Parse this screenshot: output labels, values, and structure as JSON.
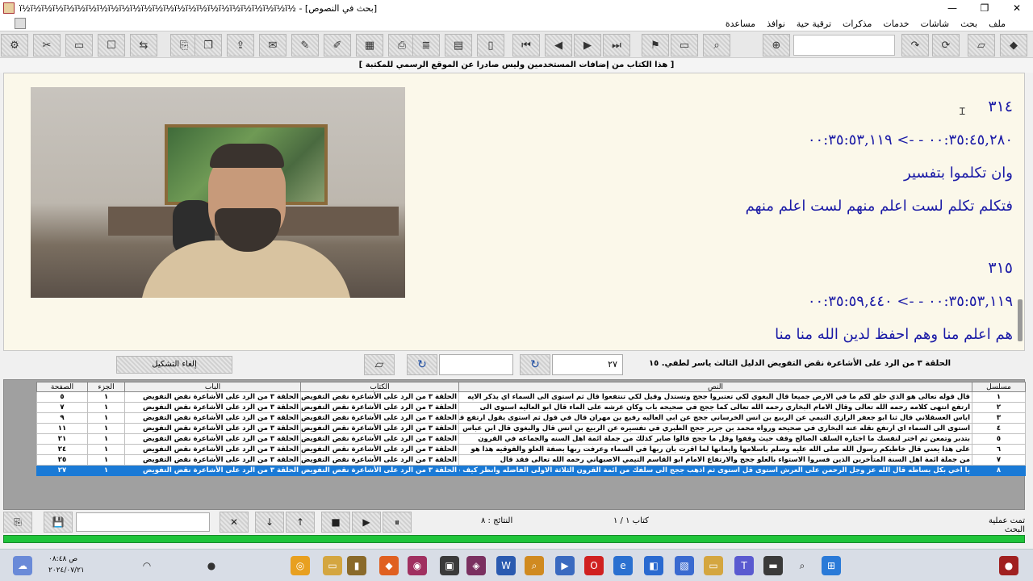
{
  "window": {
    "title": "[بحث في النصوص] - ½ï½ï½ï½ï½ï½ï½ï½ï½ï½ï½ï½ï½ï½ï½ï½ï½ï½ï½ï½ï½ï½ï½ï½ï½ï",
    "minimize": "—",
    "maximize": "❐",
    "close": "✕"
  },
  "menu": [
    "ملف",
    "بحث",
    "شاشات",
    "خدمات",
    "مذكرات",
    "ترقية حية",
    "نوافذ",
    "مساعدة"
  ],
  "notice": "[ هذا الكتاب من إضافات المستخدمين وليس صادرا عن الموقع الرسمي للمكتبة ]",
  "viewer": {
    "lines": [
      {
        "kind": "num",
        "text": "٣١٤"
      },
      {
        "kind": "ts",
        "text": "٠٠:٣٥:٤٥,٢٨٠ - -> ٠٠:٣٥:٥٣,١١٩"
      },
      {
        "kind": "txt",
        "text": "وان تكلموا بتفسير"
      },
      {
        "kind": "txt",
        "text": "فتكلم تكلم لست اعلم منهم لست اعلم منهم"
      },
      {
        "kind": "num",
        "text": "٣١٥"
      },
      {
        "kind": "ts",
        "text": "٠٠:٣٥:٥٣,١١٩ - -> ٠٠:٣٥:٥٩,٤٤٠"
      },
      {
        "kind": "txt",
        "text": "هم اعلم منا وهم احفظ لدين الله منا منا"
      }
    ]
  },
  "panel": {
    "doc_title": "الحلقة ٣ من الرد على الأشاعرة نقض التفويض الدليل الثالث ياسر لطفي. ١٥",
    "page_field": "٢٧",
    "field2": "",
    "ordered_btn": "إلغاء التشكيل"
  },
  "results": {
    "headers": [
      "مسلسل",
      "النص",
      "الكتاب",
      "الباب",
      "الجزء",
      "الصفحة"
    ],
    "rows": [
      [
        "١",
        "قال قوله تعالى هو الذي خلق لكم ما في الارض جميعا قال البغوي لكي تعتبروا ججج وتستدل وقيل لكي تنتفعوا قال ثم استوى الى السماء اي يذكر الايه",
        "الحلقة ٣ من الرد على الأشاعرة نقض التفويض",
        "الحلقة ٣ من الرد على الأشاعرة نقض التفويض",
        "١",
        "٥"
      ],
      [
        "٢",
        "ارتفع انتهى كلامه رحمه الله تعالى وقال الامام البخاري رحمه الله تعالى كما ججج في صحيحه باب وكان عرشه على الماء قال ابو العاليه استوى الى",
        "الحلقة ٣ من الرد على الأشاعرة نقض التفويض",
        "الحلقة ٣ من الرد على الأشاعرة نقض التفويض",
        "١",
        "٧"
      ],
      [
        "٣",
        "اياس العسقلاني قال ثنا ابو جعفر الرازي التيمي عن الربيع بن انس الخرساني ججج عن ابي العاليه رفيع بن مهران قال في قول ثم استوى يقول ارتفع قال",
        "الحلقة ٣ من الرد على الأشاعرة نقض التفويض",
        "الحلقة ٣ من الرد على الأشاعرة نقض التفويض",
        "١",
        "٩"
      ],
      [
        "٤",
        "استوى الى السماء اي ارتفع نقله عنه البخاري في صحيحه ورواه محمد بن جرير ججج الطبري في تفسيره عن الربيع بن انس قال والبغوي قال ابن عباس",
        "الحلقة ٣ من الرد على الأشاعرة نقض التفويض",
        "الحلقة ٣ من الرد على الأشاعرة نقض التفويض",
        "١",
        "١١"
      ],
      [
        "٥",
        "بتدبر وتمعن ثم اختر لنفسك ما اختاره السلف الصالح وقف حيث وقفوا وقل ما ججج قالوا صابر كذلك من جملة ائمة اهل السنه والجماعه في القرون",
        "الحلقة ٣ من الرد على الأشاعرة نقض التفويض",
        "الحلقة ٣ من الرد على الأشاعرة نقض التفويض",
        "١",
        "٢١"
      ],
      [
        "٦",
        "على هذا يعني قال خاطبكم رسول الله صلى الله عليه وسلم باسلامها وايمانها لما اقرت بان ربها في السماء وعرفت ربها بصفة العلو والفوقيه هذا هو",
        "الحلقة ٣ من الرد على الأشاعرة نقض التفويض",
        "الحلقة ٣ من الرد على الأشاعرة نقض التفويض",
        "١",
        "٢٤"
      ],
      [
        "٧",
        "من جملة ائمة اهل السنة المتأخرين الذين فسروا الاستواء بالعلو ججج والارتفاع الامام ابو القاسم التيمي الاصبهاني رحمه الله تعالى فقد قال",
        "الحلقة ٣ من الرد على الأشاعرة نقض التفويض",
        "الحلقة ٣ من الرد على الأشاعرة نقض التفويض",
        "١",
        "٢٥"
      ],
      [
        "٨",
        "يا اخي بكل بساطه قال الله عز وجل الرحمن على العرش استوى قل استوى ثم اذهب ججج الى سلفك من ائمة القرون الثلاثة الاولى الفاضله وانظر كيف فسروا",
        "الحلقة ٣ من الرد على الأشاعرة نقض التفويض",
        "الحلقة ٣ من الرد على الأشاعرة نقض التفويض",
        "١",
        "٢٧"
      ]
    ],
    "selected_index": 7
  },
  "status": {
    "search_done": "تمت عملية البحث",
    "book_count": "كتاب ١ / ١",
    "results_count": "النتائج : ٨"
  },
  "clock": {
    "time": "ص ٠٨:٤٨",
    "date": "٢٠٢٤/٠٧/٢١"
  }
}
